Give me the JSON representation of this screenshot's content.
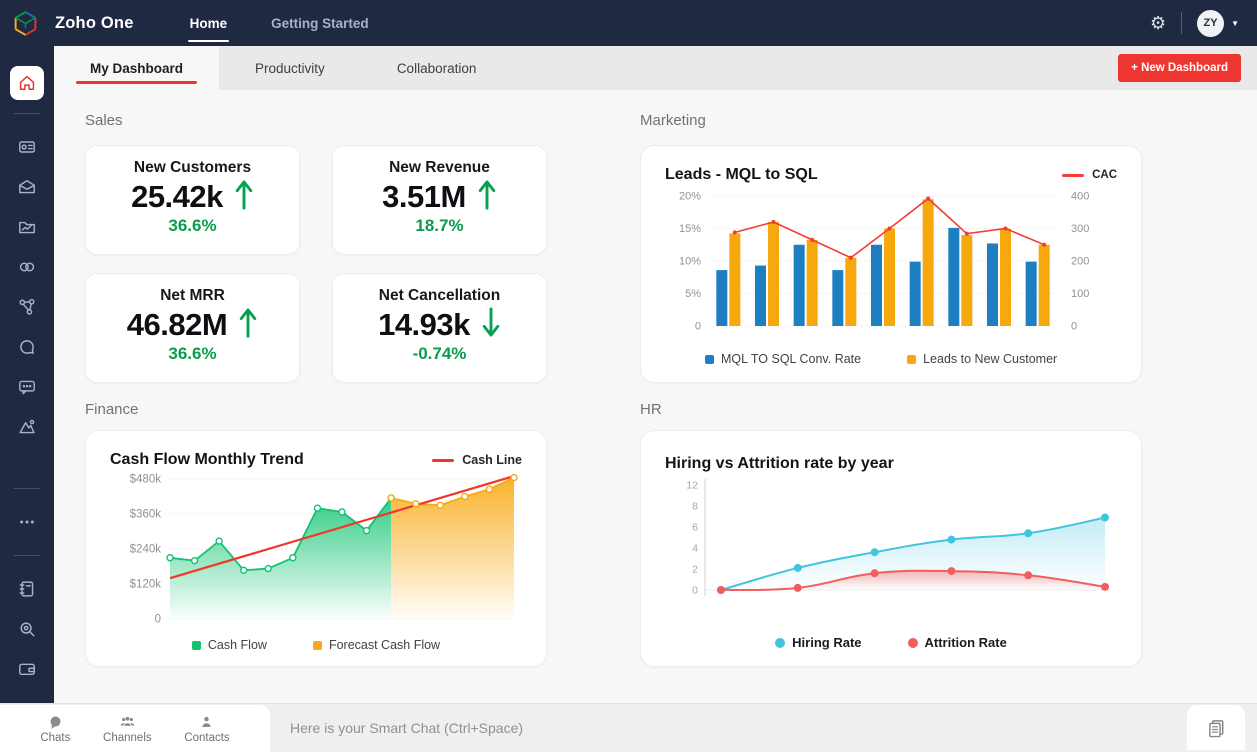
{
  "topbar": {
    "brand": "Zoho One",
    "nav": [
      {
        "label": "Home",
        "active": true
      },
      {
        "label": "Getting Started",
        "active": false
      }
    ],
    "avatar_initials": "ZY"
  },
  "sidebar": {
    "icons": [
      "home",
      "cards",
      "mail",
      "folder-chart",
      "crm-links",
      "network",
      "chat",
      "message",
      "analytics",
      "more",
      "notebook",
      "search",
      "wallet"
    ]
  },
  "tabs": {
    "items": [
      {
        "label": "My Dashboard",
        "active": true
      },
      {
        "label": "Productivity",
        "active": false
      },
      {
        "label": "Collaboration",
        "active": false
      }
    ],
    "new_dashboard": "+ New Dashboard"
  },
  "sections": {
    "sales": {
      "title": "Sales",
      "cards": [
        {
          "title": "New Customers",
          "value": "25.42k",
          "change": "36.6%",
          "direction": "up"
        },
        {
          "title": "New Revenue",
          "value": "3.51M",
          "change": "18.7%",
          "direction": "up"
        },
        {
          "title": "Net MRR",
          "value": "46.82M",
          "change": "36.6%",
          "direction": "up"
        },
        {
          "title": "Net Cancellation",
          "value": "14.93k",
          "change": "-0.74%",
          "direction": "down"
        }
      ]
    },
    "marketing": {
      "title": "Marketing"
    },
    "finance": {
      "title": "Finance"
    },
    "hr": {
      "title": "HR"
    }
  },
  "chart_data": [
    {
      "id": "marketing",
      "type": "bar",
      "title": "Leads - MQL to SQL",
      "legend_top": {
        "label": "CAC",
        "color": "#f23e36"
      },
      "left_axis": {
        "ticks": [
          "20%",
          "15%",
          "10%",
          "5%",
          "0"
        ],
        "max": 20
      },
      "right_axis": {
        "ticks": [
          "400",
          "300",
          "200",
          "100",
          "0"
        ],
        "max": 400
      },
      "series": [
        {
          "name": "MQL TO SQL Conv. Rate",
          "type": "bar",
          "axis": "left",
          "color": "#1d7fc2",
          "values": [
            8.6,
            9.3,
            12.5,
            8.6,
            12.5,
            9.9,
            15.1,
            12.7,
            9.9
          ]
        },
        {
          "name": "Leads to New Customer",
          "type": "bar",
          "axis": "right",
          "color": "#f7a80d",
          "values": [
            285,
            320,
            265,
            210,
            300,
            390,
            280,
            300,
            250
          ]
        },
        {
          "name": "CAC",
          "type": "line",
          "axis": "right",
          "color": "#f23e36",
          "values": [
            288,
            320,
            265,
            210,
            300,
            392,
            284,
            300,
            250
          ]
        }
      ],
      "legend_bottom": [
        "MQL TO SQL Conv. Rate",
        "Leads to New Customer"
      ],
      "grid": "dotted-horizontal",
      "legend_position": "bottom-left"
    },
    {
      "id": "finance",
      "type": "area",
      "title": "Cash Flow Monthly Trend",
      "legend_top": {
        "label": "Cash Line",
        "color": "#f0372e"
      },
      "y_axis": {
        "ticks": [
          "$480k",
          "$360k",
          "$240k",
          "$120k",
          "0"
        ],
        "max": 480
      },
      "x_count": 15,
      "series": [
        {
          "name": "Cash Flow",
          "color": "#10c470",
          "x_start": 0,
          "values": [
            210,
            200,
            267,
            167,
            173,
            210,
            380,
            367,
            303,
            415
          ]
        },
        {
          "name": "Forecast Cash Flow",
          "color": "#f8aa12",
          "x_start": 9,
          "values": [
            415,
            395,
            390,
            420,
            445,
            485
          ]
        }
      ],
      "trendline": {
        "name": "Cash Line",
        "color": "#f0372e",
        "start_value": 140,
        "end_value": 490
      },
      "legend_bottom": [
        "Cash Flow",
        "Forecast Cash Flow"
      ],
      "grid": "dotted-horizontal",
      "legend_position": "bottom-center"
    },
    {
      "id": "hr",
      "type": "line",
      "title": "Hiring vs Attrition rate by year",
      "y_axis": {
        "ticks": [
          "12",
          "8",
          "6",
          "4",
          "2",
          "0"
        ]
      },
      "series": [
        {
          "name": "Hiring Rate",
          "color": "#41c4e0",
          "values": [
            0,
            2.1,
            3.6,
            4.8,
            5.4,
            6.9
          ]
        },
        {
          "name": "Attrition Rate",
          "color": "#f25d5d",
          "values": [
            0,
            0.2,
            1.6,
            1.8,
            1.4,
            0.3
          ]
        }
      ],
      "legend_bottom": [
        "Hiring Rate",
        "Attrition Rate"
      ],
      "grid": "y-axis-only",
      "legend_position": "bottom-center"
    }
  ],
  "bottombar": {
    "items": [
      {
        "label": "Chats",
        "icon": "chat-bubble"
      },
      {
        "label": "Channels",
        "icon": "people"
      },
      {
        "label": "Contacts",
        "icon": "person"
      }
    ],
    "smart_chat_text": "Here is your Smart Chat (Ctrl+Space)",
    "right_icon": "documents"
  },
  "colors": {
    "navy": "#1f2a42",
    "accent_red": "#ee352f",
    "kpi_green": "#0a9b4b",
    "bar_blue": "#1d7fc2",
    "bar_orange": "#f7a80d",
    "line_red": "#f23e36",
    "area_green": "#10c470",
    "area_orange": "#f8aa12",
    "hr_cyan": "#41c4e0",
    "hr_pink": "#f25d5d"
  }
}
